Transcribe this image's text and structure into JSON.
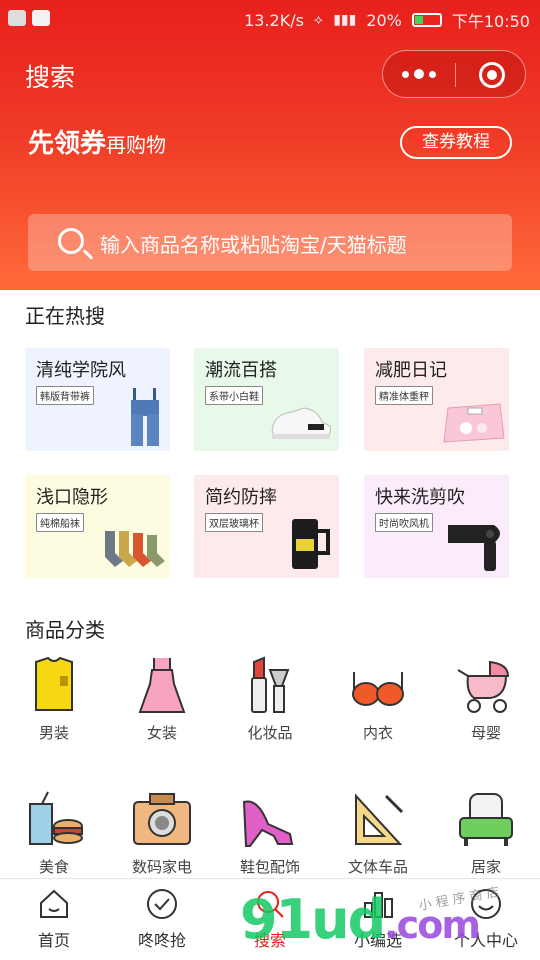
{
  "status": {
    "speed": "13.2K/s",
    "battery": "20%",
    "time": "下午10:50"
  },
  "header": {
    "title": "搜索"
  },
  "promo": {
    "strong": "先领券",
    "rest": "再购物",
    "tutorial": "查券教程"
  },
  "search": {
    "placeholder": "输入商品名称或粘贴淘宝/天猫标题"
  },
  "hot": {
    "title": "正在热搜",
    "items": [
      {
        "title": "清纯学院风",
        "tag": "韩版背带裤",
        "icon": "overalls-icon",
        "bg": "#eef3ff"
      },
      {
        "title": "潮流百搭",
        "tag": "系带小白鞋",
        "icon": "sneaker-icon",
        "bg": "#e9f9e9"
      },
      {
        "title": "减肥日记",
        "tag": "精准体重秤",
        "icon": "scale-icon",
        "bg": "#fdeaea"
      },
      {
        "title": "浅口隐形",
        "tag": "纯棉船袜",
        "icon": "socks-icon",
        "bg": "#fdfce0"
      },
      {
        "title": "简约防摔",
        "tag": "双层玻璃杯",
        "icon": "mug-icon",
        "bg": "#fdeaea"
      },
      {
        "title": "快来洗剪吹",
        "tag": "时尚吹风机",
        "icon": "hairdryer-icon",
        "bg": "#fbecfb"
      }
    ]
  },
  "categories": {
    "title": "商品分类",
    "items": [
      {
        "label": "男装",
        "icon": "tshirt-icon"
      },
      {
        "label": "女装",
        "icon": "dress-icon"
      },
      {
        "label": "化妆品",
        "icon": "cosmetics-icon"
      },
      {
        "label": "内衣",
        "icon": "bra-icon"
      },
      {
        "label": "母婴",
        "icon": "stroller-icon"
      },
      {
        "label": "美食",
        "icon": "food-icon"
      },
      {
        "label": "数码家电",
        "icon": "camera-icon"
      },
      {
        "label": "鞋包配饰",
        "icon": "high-heel-icon"
      },
      {
        "label": "文体车品",
        "icon": "ruler-icon"
      },
      {
        "label": "居家",
        "icon": "sofa-icon"
      }
    ]
  },
  "tabs": [
    {
      "label": "首页",
      "icon": "home-icon"
    },
    {
      "label": "咚咚抢",
      "icon": "check-clock-icon"
    },
    {
      "label": "搜索",
      "icon": "search-icon"
    },
    {
      "label": "小编选",
      "icon": "chart-icon"
    },
    {
      "label": "个人中心",
      "icon": "smile-icon"
    }
  ],
  "watermark": {
    "main": "91ud",
    "com": ".com",
    "small": "小 程 序 商 店"
  },
  "colors": {
    "brand": "#e8201d",
    "gradient_end": "#ff6a3a"
  }
}
